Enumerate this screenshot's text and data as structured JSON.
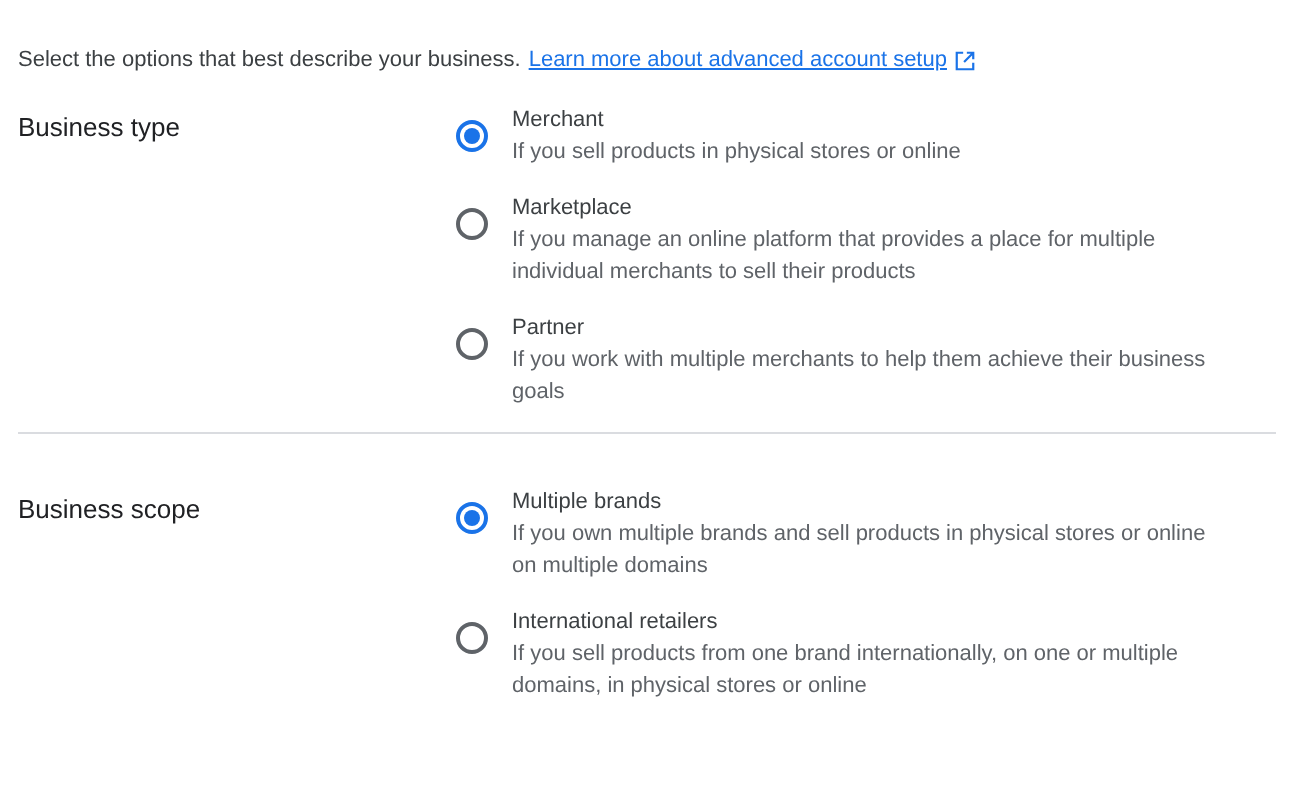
{
  "intro": {
    "text": "Select the options that best describe your business.",
    "link": "Learn more about advanced account setup"
  },
  "sections": [
    {
      "label": "Business type",
      "options": [
        {
          "title": "Merchant",
          "description": "If you sell products in physical stores or online",
          "selected": true
        },
        {
          "title": "Marketplace",
          "description": "If you manage an online platform that provides a place for multiple individual merchants to sell their products",
          "selected": false
        },
        {
          "title": "Partner",
          "description": "If you work with multiple merchants to help them achieve their business goals",
          "selected": false
        }
      ]
    },
    {
      "label": "Business scope",
      "options": [
        {
          "title": "Multiple brands",
          "description": "If you own multiple brands and sell products in physical stores or online on multiple domains",
          "selected": true
        },
        {
          "title": "International retailers",
          "description": "If you sell products from one brand internationally, on one or multiple domains, in physical stores or online",
          "selected": false
        }
      ]
    }
  ]
}
